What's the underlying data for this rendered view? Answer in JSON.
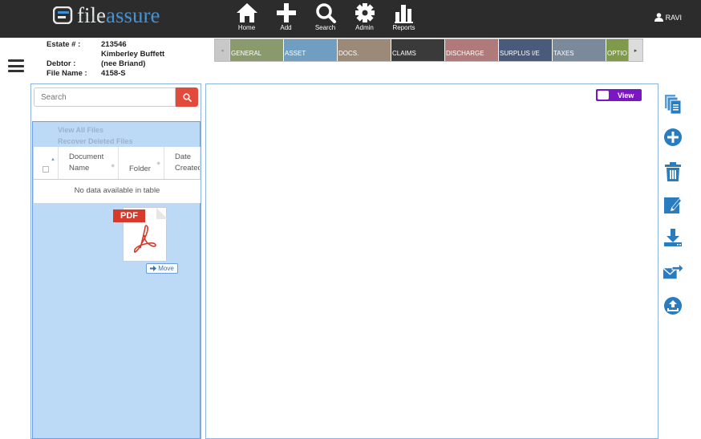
{
  "app": {
    "logo_part1": "file",
    "logo_part2": "assure"
  },
  "nav": [
    {
      "label": "Home",
      "icon": "home-icon"
    },
    {
      "label": "Add",
      "icon": "plus-icon"
    },
    {
      "label": "Search",
      "icon": "search-icon"
    },
    {
      "label": "Admin",
      "icon": "gear-icon"
    },
    {
      "label": "Reports",
      "icon": "bar-chart-icon"
    }
  ],
  "user": {
    "name": "RAVI"
  },
  "estate_info": {
    "estate_label": "Estate # :",
    "estate_number": "213546",
    "debtor_label": "Debtor :",
    "debtor_name": "Kimberley Buffett",
    "debtor_alias": "(nee Briand)",
    "file_label": "File Name :",
    "file_name": "4158-S"
  },
  "tabs": [
    {
      "label": "GENERAL",
      "color": "#8a9a6c"
    },
    {
      "label": "ASSET",
      "color": "#6f9ec0"
    },
    {
      "label": "DOCS.",
      "color": "#9b8a78"
    },
    {
      "label": "CLAIMS",
      "color": "#3a3a3a"
    },
    {
      "label": "DISCHARGE",
      "color": "#b07a7a"
    },
    {
      "label": "SURPLUS I/E",
      "color": "#4a5a7a"
    },
    {
      "label": "TAXES",
      "color": "#7a8a9a"
    },
    {
      "label": "OPTIO",
      "color": "#7e9a4a"
    }
  ],
  "files": {
    "search_placeholder": "Search",
    "view_all": "View All Files",
    "recover_deleted": "Recover Deleted Files",
    "col_document_line1": "Document",
    "col_document_line2": "Name",
    "col_folder": "Folder",
    "col_date_line1": "Date",
    "col_date_line2": "Created",
    "empty_message": "No data available in table",
    "drag_file_label": "PDF",
    "move_label": "Move"
  },
  "viewer": {
    "view_label": "View"
  },
  "actions": [
    {
      "icon": "copy-documents-icon"
    },
    {
      "icon": "add-circle-icon"
    },
    {
      "icon": "trash-icon"
    },
    {
      "icon": "edit-icon"
    },
    {
      "icon": "download-icon"
    },
    {
      "icon": "send-mail-icon"
    },
    {
      "icon": "upload-icon"
    }
  ],
  "colors": {
    "accent_blue": "#2a7cc0",
    "search_red": "#e24a3b",
    "toggle_purple": "#7b16c0",
    "panel_blue": "#bcd9f6"
  }
}
